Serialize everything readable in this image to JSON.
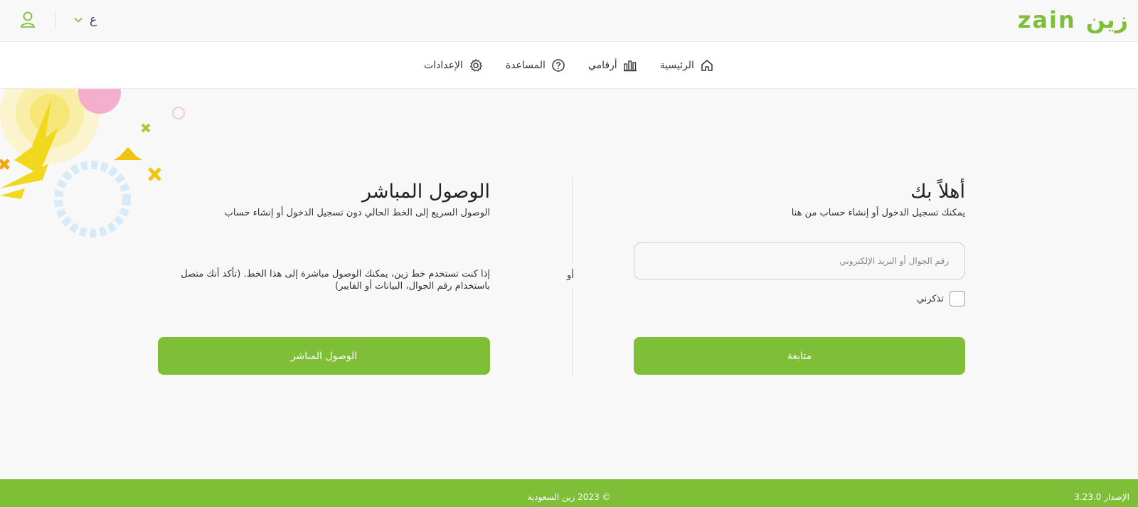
{
  "brand": {
    "logo_latin": "zain",
    "logo_arabic": "زين",
    "accent_color": "#7fbe37"
  },
  "header": {
    "language_value": "ع",
    "user_icon": "user-icon",
    "chevron_icon": "chevron-down-icon"
  },
  "nav": {
    "items": [
      {
        "label": "الرئيسية",
        "icon": "home-icon"
      },
      {
        "label": "أرقامي",
        "icon": "bar-chart-icon"
      },
      {
        "label": "المساعدة",
        "icon": "help-icon"
      },
      {
        "label": "الإعدادات",
        "icon": "gear-icon"
      }
    ]
  },
  "login": {
    "title": "أهلاً بك",
    "subtitle": "يمكنك تسجيل الدخول أو إنشاء حساب من هنا",
    "input_placeholder": "رقم الجوال أو البريد الإلكتروني",
    "remember_label": "تذكرني",
    "continue_label": "متابعة"
  },
  "divider": {
    "or_label": "أو"
  },
  "direct": {
    "title": "الوصول المباشر",
    "subtitle": "الوصول السريع إلى الخط الحالي دون تسجيل الدخول أو إنشاء حساب",
    "description_line1": "إذا كنت تستخدم خط زين، يمكنك الوصول مباشرة إلى هذا الخط. (تأكد أنك متصل",
    "description_line2": "باستخدام رقم الجوال، البيانات أو الفايبر)",
    "button_label": "الوصول المباشر"
  },
  "footer": {
    "copyright": "© 2023 زين السعودية",
    "version": "الإصدار 3.23.0"
  }
}
